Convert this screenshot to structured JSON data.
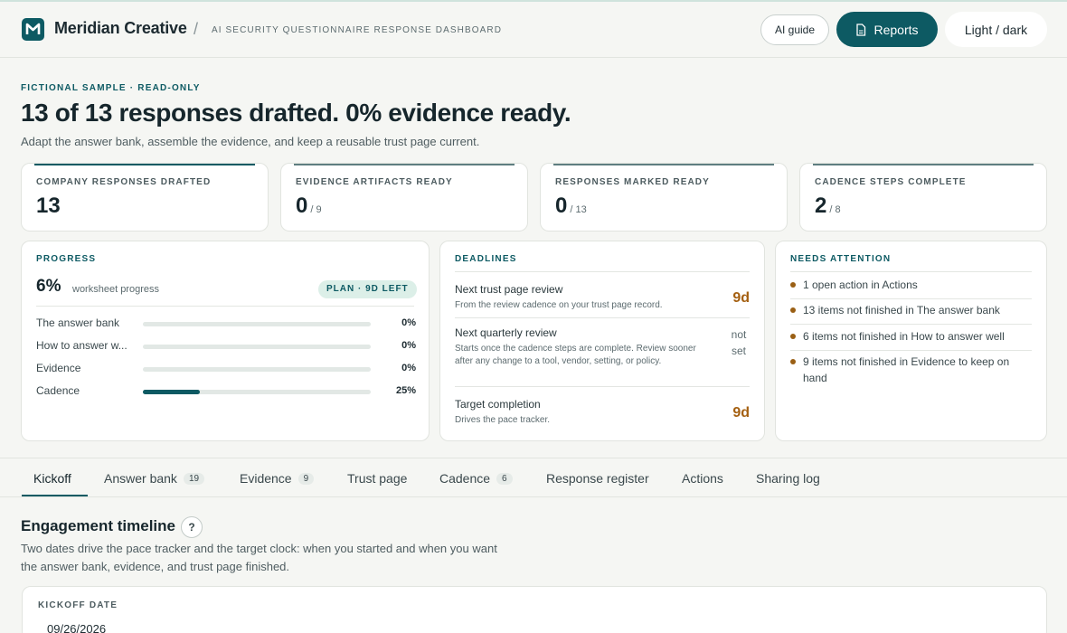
{
  "header": {
    "brand": "Meridian Creative",
    "separator": "/",
    "subtitle": "AI SECURITY QUESTIONNAIRE RESPONSE DASHBOARD",
    "ai_guide_label": "AI guide",
    "reports_label": "Reports",
    "theme_label": "Light / dark"
  },
  "hero": {
    "eyebrow": "FICTIONAL SAMPLE · READ-ONLY",
    "title": "13 of 13 responses drafted. 0% evidence ready.",
    "subtitle": "Adapt the answer bank, assemble the evidence, and keep a reusable trust page current."
  },
  "stats": [
    {
      "label": "COMPANY RESPONSES DRAFTED",
      "value": "13",
      "denominator": ""
    },
    {
      "label": "EVIDENCE ARTIFACTS READY",
      "value": "0",
      "denominator": "/ 9"
    },
    {
      "label": "RESPONSES MARKED READY",
      "value": "0",
      "denominator": "/ 13"
    },
    {
      "label": "CADENCE STEPS COMPLETE",
      "value": "2",
      "denominator": "/ 8"
    }
  ],
  "progress": {
    "title": "PROGRESS",
    "percent": "6%",
    "caption": "worksheet progress",
    "pill": "PLAN · 9D LEFT",
    "rows": [
      {
        "name": "The answer bank",
        "value": "0%",
        "fraction": 0
      },
      {
        "name": "How to answer w...",
        "value": "0%",
        "fraction": 0
      },
      {
        "name": "Evidence",
        "value": "0%",
        "fraction": 0
      },
      {
        "name": "Cadence",
        "value": "25%",
        "fraction": 0.25
      }
    ]
  },
  "deadlines": {
    "title": "DEADLINES",
    "items": [
      {
        "title": "Next trust page review",
        "desc": "From the review cadence on your trust page record.",
        "value": "9d"
      },
      {
        "title": "Next quarterly review",
        "desc": "Starts once the cadence steps are complete. Review sooner after any change to a tool, vendor, setting, or policy.",
        "value": "not set"
      },
      {
        "title": "Target completion",
        "desc": "Drives the pace tracker.",
        "value": "9d"
      }
    ]
  },
  "attention": {
    "title": "NEEDS ATTENTION",
    "items": [
      "1 open action in Actions",
      "13 items not finished in The answer bank",
      "6 items not finished in How to answer well",
      "9 items not finished in Evidence to keep on hand"
    ]
  },
  "tabs": [
    {
      "label": "Kickoff",
      "count": ""
    },
    {
      "label": "Answer bank",
      "count": "19"
    },
    {
      "label": "Evidence",
      "count": "9"
    },
    {
      "label": "Trust page",
      "count": ""
    },
    {
      "label": "Cadence",
      "count": "6"
    },
    {
      "label": "Response register",
      "count": ""
    },
    {
      "label": "Actions",
      "count": ""
    },
    {
      "label": "Sharing log",
      "count": ""
    }
  ],
  "section": {
    "title": "Engagement timeline",
    "help": "?",
    "description": "Two dates drive the pace tracker and the target clock: when you started and when you want the answer bank, evidence, and trust page finished.",
    "kickoff_label": "KICKOFF DATE",
    "kickoff_value": "09/26/2026"
  },
  "colors": {
    "accent": "#0d5a63",
    "warning": "#a45f10",
    "background": "#f5f6f3"
  }
}
